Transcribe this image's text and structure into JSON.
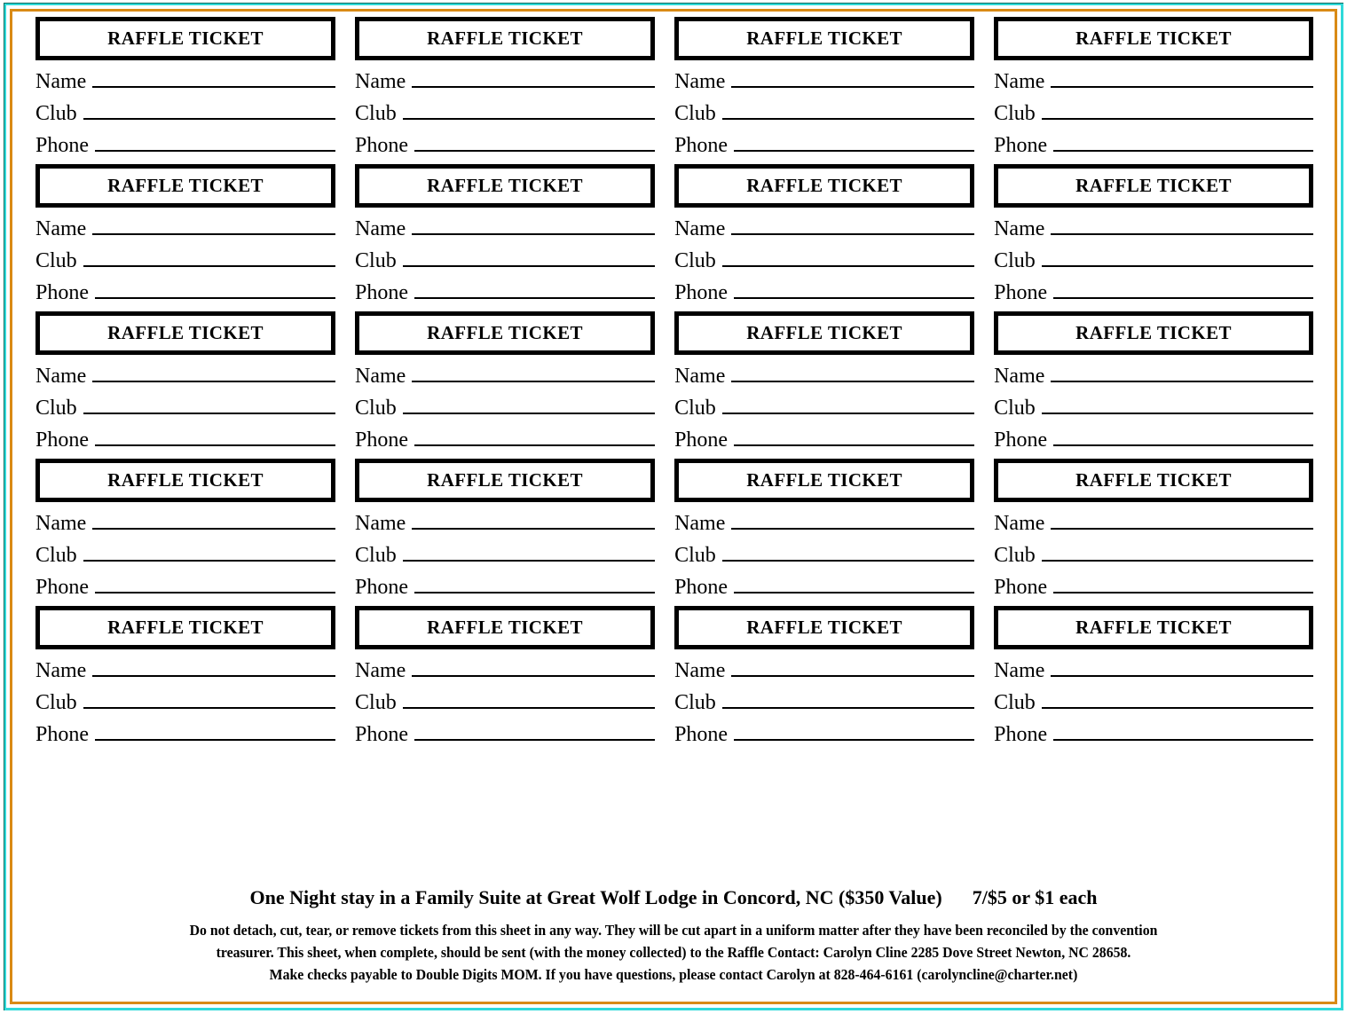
{
  "page": {
    "title": "Raffle Ticket Sheet",
    "border_outer_color": "#2fd9d9",
    "border_inner_color": "#d98a15",
    "background_color": "#ffffff",
    "ink_color": "#000000",
    "columns": 4,
    "rows": 5,
    "total_tickets": 20
  },
  "ticket": {
    "heading": "RAFFLE TICKET",
    "fields": [
      {
        "label": "Name"
      },
      {
        "label": "Club"
      },
      {
        "label": "Phone"
      }
    ]
  },
  "tickets": [
    {
      "id": "r1c1",
      "heading": "RAFFLE TICKET",
      "name": "",
      "club": "",
      "phone": ""
    },
    {
      "id": "r1c2",
      "heading": "RAFFLE TICKET",
      "name": "",
      "club": "",
      "phone": ""
    },
    {
      "id": "r1c3",
      "heading": "RAFFLE TICKET",
      "name": "",
      "club": "",
      "phone": ""
    },
    {
      "id": "r1c4",
      "heading": "RAFFLE TICKET",
      "name": "",
      "club": "",
      "phone": ""
    },
    {
      "id": "r2c1",
      "heading": "RAFFLE TICKET",
      "name": "",
      "club": "",
      "phone": ""
    },
    {
      "id": "r2c2",
      "heading": "RAFFLE TICKET",
      "name": "",
      "club": "",
      "phone": ""
    },
    {
      "id": "r2c3",
      "heading": "RAFFLE TICKET",
      "name": "",
      "club": "",
      "phone": ""
    },
    {
      "id": "r2c4",
      "heading": "RAFFLE TICKET",
      "name": "",
      "club": "",
      "phone": ""
    },
    {
      "id": "r3c1",
      "heading": "RAFFLE TICKET",
      "name": "",
      "club": "",
      "phone": ""
    },
    {
      "id": "r3c2",
      "heading": "RAFFLE TICKET",
      "name": "",
      "club": "",
      "phone": ""
    },
    {
      "id": "r3c3",
      "heading": "RAFFLE TICKET",
      "name": "",
      "club": "",
      "phone": ""
    },
    {
      "id": "r3c4",
      "heading": "RAFFLE TICKET",
      "name": "",
      "club": "",
      "phone": ""
    },
    {
      "id": "r4c1",
      "heading": "RAFFLE TICKET",
      "name": "",
      "club": "",
      "phone": ""
    },
    {
      "id": "r4c2",
      "heading": "RAFFLE TICKET",
      "name": "",
      "club": "",
      "phone": ""
    },
    {
      "id": "r4c3",
      "heading": "RAFFLE TICKET",
      "name": "",
      "club": "",
      "phone": ""
    },
    {
      "id": "r4c4",
      "heading": "RAFFLE TICKET",
      "name": "",
      "club": "",
      "phone": ""
    },
    {
      "id": "r5c1",
      "heading": "RAFFLE TICKET",
      "name": "",
      "club": "",
      "phone": ""
    },
    {
      "id": "r5c2",
      "heading": "RAFFLE TICKET",
      "name": "",
      "club": "",
      "phone": ""
    },
    {
      "id": "r5c3",
      "heading": "RAFFLE TICKET",
      "name": "",
      "club": "",
      "phone": ""
    },
    {
      "id": "r5c4",
      "heading": "RAFFLE TICKET",
      "name": "",
      "club": "",
      "phone": ""
    }
  ],
  "footer": {
    "prize_description": "One Night stay in a Family Suite at Great Wolf  Lodge in Concord, NC  ($350 Value)",
    "price": "7/$5 or $1 each",
    "fineprint_lines": [
      "Do not detach, cut, tear, or remove tickets from this sheet in any way.  They will be cut apart in a uniform matter after they have been reconciled by the convention",
      "treasurer.  This sheet, when complete, should be sent (with the money collected) to the Raffle Contact:  Carolyn Cline 2285 Dove Street Newton, NC 28658.",
      "Make checks payable to Double Digits MOM.    If you have questions, please contact Carolyn at 828-464-6161 (carolyncline@charter.net)"
    ],
    "contact_name": "Carolyn Cline",
    "contact_address": "2285 Dove Street Newton, NC 28658",
    "contact_phone": "828-464-6161",
    "contact_email": "carolyncline@charter.net",
    "payee": "Double Digits MOM"
  }
}
